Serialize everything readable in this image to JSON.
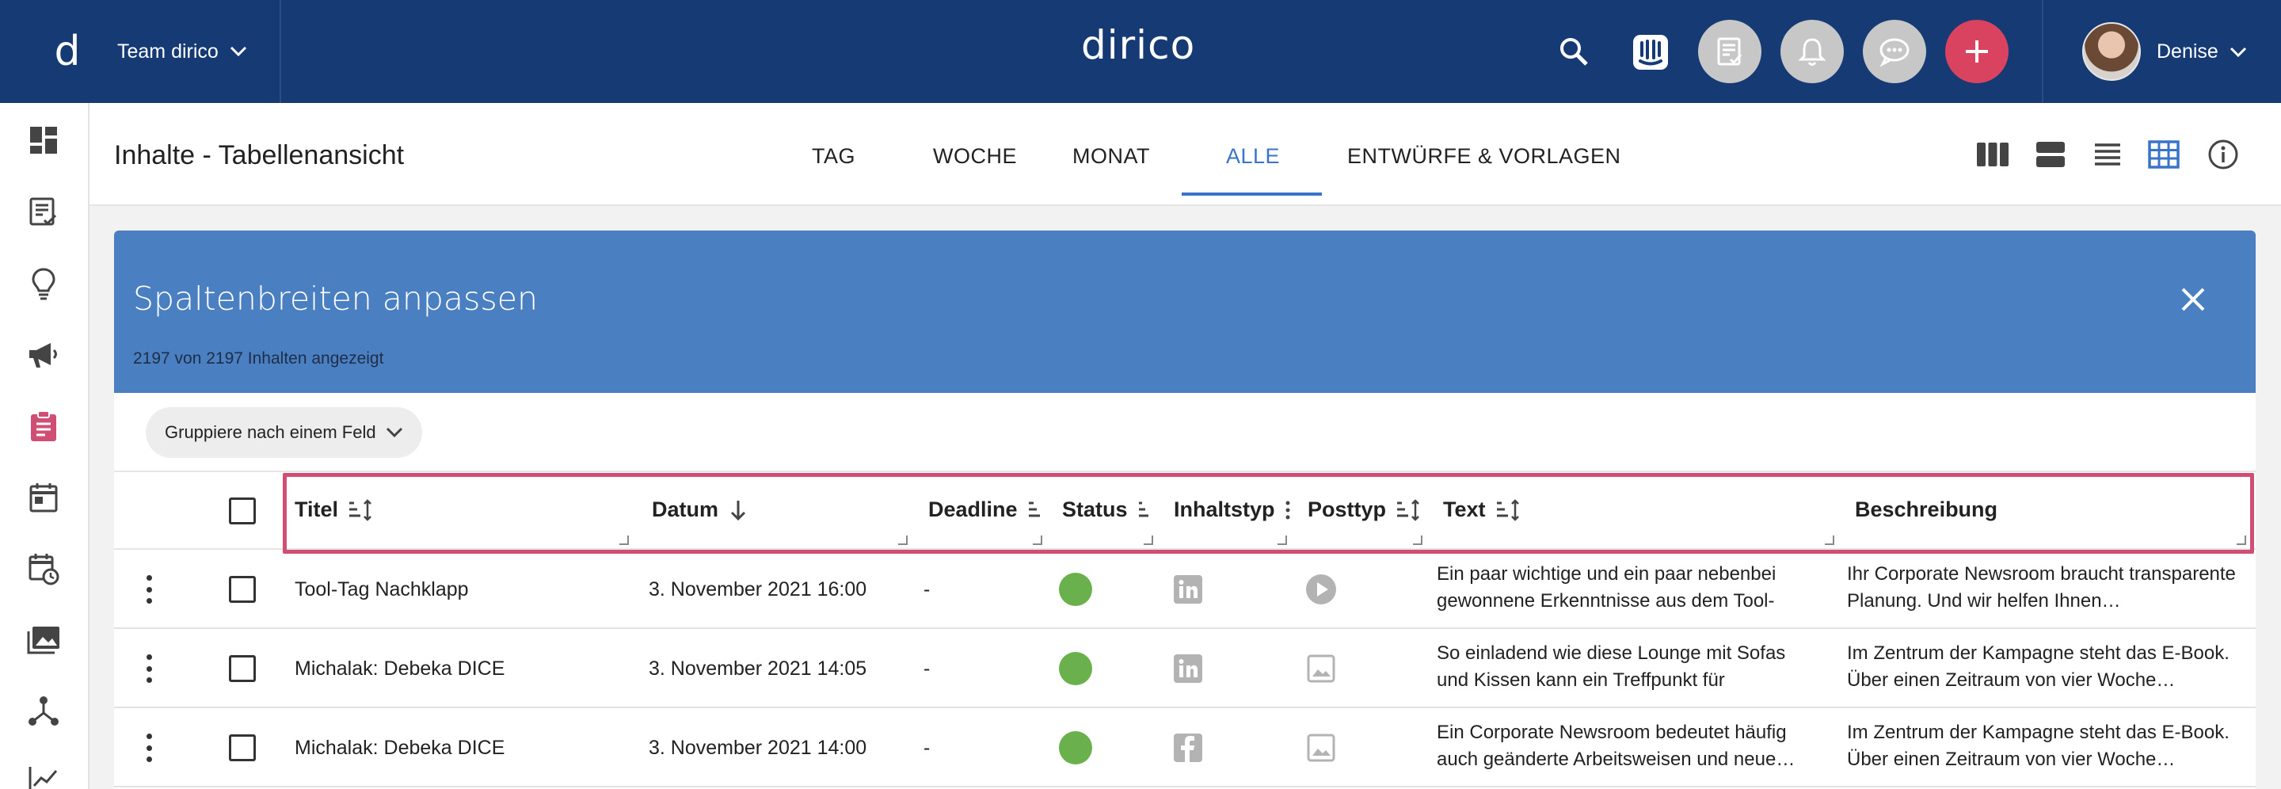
{
  "topbar": {
    "logo_letter": "d",
    "team_name": "Team dirico",
    "brand": "dirico",
    "user_name": "Denise"
  },
  "subheader": {
    "page_title": "Inhalte - Tabellenansicht",
    "tabs": [
      {
        "label": "TAG"
      },
      {
        "label": "WOCHE"
      },
      {
        "label": "MONAT"
      },
      {
        "label": "ALLE"
      },
      {
        "label": "ENTWÜRFE & VORLAGEN"
      }
    ],
    "active_tab": "ALLE"
  },
  "panel": {
    "title": "Spaltenbreiten anpassen",
    "count_text": "2197 von 2197 Inhalten angezeigt"
  },
  "table": {
    "group_by_label": "Gruppiere nach einem Feld",
    "columns": [
      "Titel",
      "Datum",
      "Deadline",
      "Status",
      "Inhaltstyp",
      "Posttyp",
      "Text",
      "Beschreibung"
    ],
    "rows": [
      {
        "title": "Tool-Tag Nachklapp",
        "date": "3. November 2021 16:00",
        "deadline": "-",
        "status_color": "#6ab04c",
        "content_type_icon": "linkedin-icon",
        "post_type_icon": "play-icon",
        "text": "Ein paar wichtige und ein paar nebenbei gewonnene Erkenntnisse aus dem Tool-Ta…",
        "description": "Ihr Corporate Newsroom braucht transparente Planung. Und wir helfen Ihnen…"
      },
      {
        "title": "Michalak: Debeka DICE",
        "date": "3. November 2021 14:05",
        "deadline": "-",
        "status_color": "#6ab04c",
        "content_type_icon": "linkedin-icon",
        "post_type_icon": "image-icon",
        "text": "So einladend wie diese Lounge mit Sofas und Kissen kann ein Treffpunkt für kreative…",
        "description": "Im Zentrum der Kampagne steht das E-Book. Über einen Zeitraum von vier Woche…"
      },
      {
        "title": "Michalak: Debeka DICE",
        "date": "3. November 2021 14:00",
        "deadline": "-",
        "status_color": "#6ab04c",
        "content_type_icon": "facebook-icon",
        "post_type_icon": "image-icon",
        "text": "Ein Corporate Newsroom bedeutet häufig auch geänderte Arbeitsweisen und neue…",
        "description": "Im Zentrum der Kampagne steht das E-Book. Über einen Zeitraum von vier Woche…"
      }
    ]
  },
  "colors": {
    "topbar": "#163a73",
    "accent": "#3a74c8",
    "panel": "#4a7fc1",
    "highlight": "#d04d74",
    "add_button": "#d9435f"
  }
}
